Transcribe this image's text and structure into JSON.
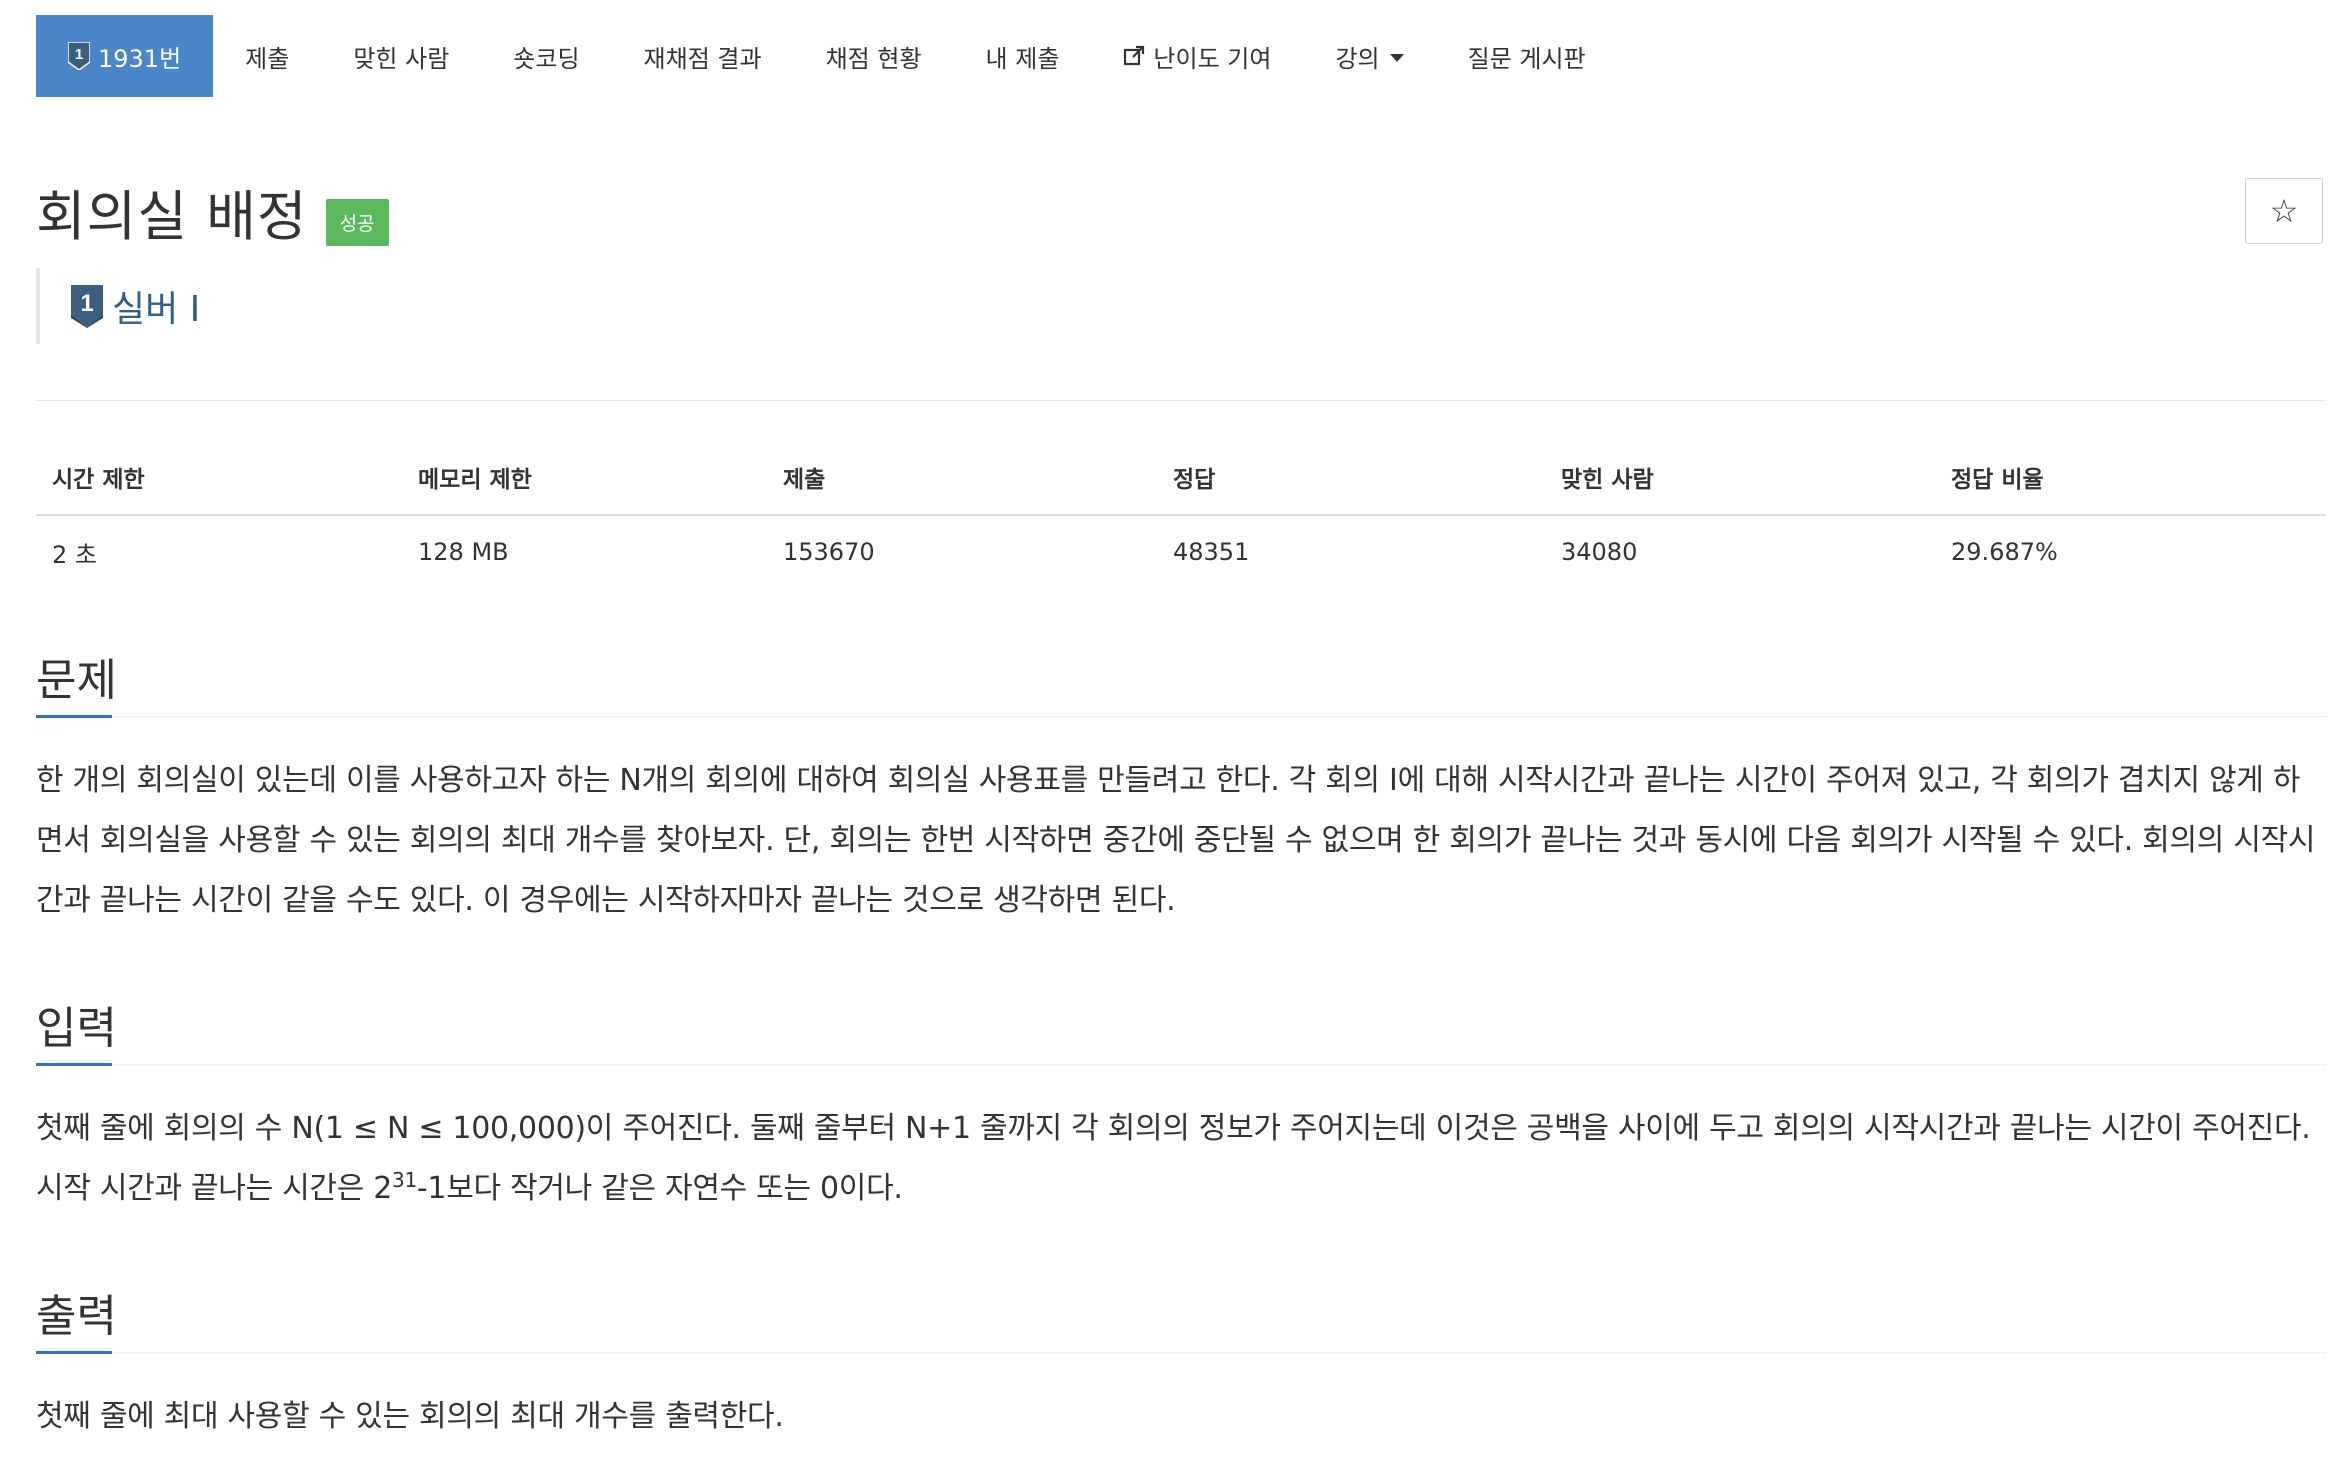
{
  "nav": {
    "items": [
      {
        "label": "1931번",
        "active": true,
        "icon": "tier-silver1-icon"
      },
      {
        "label": "제출"
      },
      {
        "label": "맞힌 사람"
      },
      {
        "label": "숏코딩"
      },
      {
        "label": "재채점 결과"
      },
      {
        "label": "채점 현황"
      },
      {
        "label": "내 제출"
      },
      {
        "label": "난이도 기여",
        "icon": "external-link-icon"
      },
      {
        "label": "강의",
        "icon": "caret-down-icon"
      },
      {
        "label": "질문 게시판"
      }
    ]
  },
  "problem": {
    "title": "회의실 배정",
    "status_badge": "성공",
    "star_icon": "☆",
    "tier_label": "실버 I",
    "tier_number": "1"
  },
  "stats": {
    "headers": [
      "시간 제한",
      "메모리 제한",
      "제출",
      "정답",
      "맞힌 사람",
      "정답 비율"
    ],
    "values": [
      "2 초",
      "128 MB",
      "153670",
      "48351",
      "34080",
      "29.687%"
    ]
  },
  "sections": {
    "problem": {
      "title": "문제",
      "text": "한 개의 회의실이 있는데 이를 사용하고자 하는 N개의 회의에 대하여 회의실 사용표를 만들려고 한다. 각 회의 I에 대해 시작시간과 끝나는 시간이 주어져 있고, 각 회의가 겹치지 않게 하면서 회의실을 사용할 수 있는 회의의 최대 개수를 찾아보자. 단, 회의는 한번 시작하면 중간에 중단될 수 없으며 한 회의가 끝나는 것과 동시에 다음 회의가 시작될 수 있다. 회의의 시작시간과 끝나는 시간이 같을 수도 있다. 이 경우에는 시작하자마자 끝나는 것으로 생각하면 된다."
    },
    "input": {
      "title": "입력",
      "text_before": "첫째 줄에 회의의 수 N(1 ≤ N ≤ 100,000)이 주어진다. 둘째 줄부터 N+1 줄까지 각 회의의 정보가 주어지는데 이것은 공백을 사이에 두고 회의의 시작시간과 끝나는 시간이 주어진다. 시작 시간과 끝나는 시간은 2",
      "superscript": "31",
      "text_after": "-1보다 작거나 같은 자연수 또는 0이다."
    },
    "output": {
      "title": "출력",
      "text": "첫째 줄에 최대 사용할 수 있는 회의의 최대 개수를 출력한다."
    }
  },
  "colors": {
    "nav_active": "#4a86c8",
    "badge_success": "#5cb85c",
    "section_underline": "#2d74c0",
    "tier_text": "#2f5e87"
  }
}
